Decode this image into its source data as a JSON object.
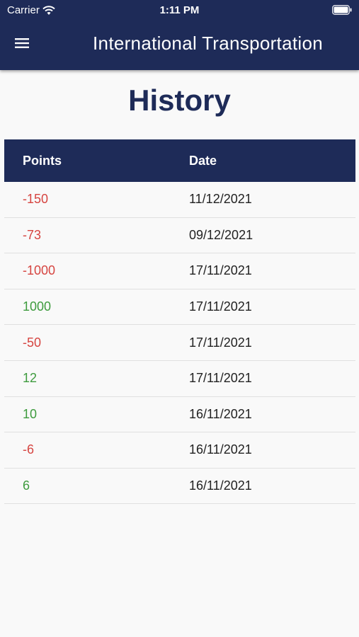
{
  "status_bar": {
    "carrier": "Carrier",
    "time": "1:11 PM"
  },
  "header": {
    "title": "International Transportation",
    "menu_icon": "hamburger-menu-icon",
    "color": "#1e2b58"
  },
  "page": {
    "title": "History"
  },
  "history_table": {
    "columns": [
      "Points",
      "Date"
    ],
    "rows": [
      {
        "points": "-150",
        "date": "11/12/2021"
      },
      {
        "points": "-73",
        "date": "09/12/2021"
      },
      {
        "points": "-1000",
        "date": "17/11/2021"
      },
      {
        "points": "1000",
        "date": "17/11/2021"
      },
      {
        "points": "-50",
        "date": "17/11/2021"
      },
      {
        "points": "12",
        "date": "17/11/2021"
      },
      {
        "points": "10",
        "date": "16/11/2021"
      },
      {
        "points": "-6",
        "date": "16/11/2021"
      },
      {
        "points": "6",
        "date": "16/11/2021"
      }
    ],
    "negative_color": "#d64541",
    "positive_color": "#3e9b3e"
  }
}
